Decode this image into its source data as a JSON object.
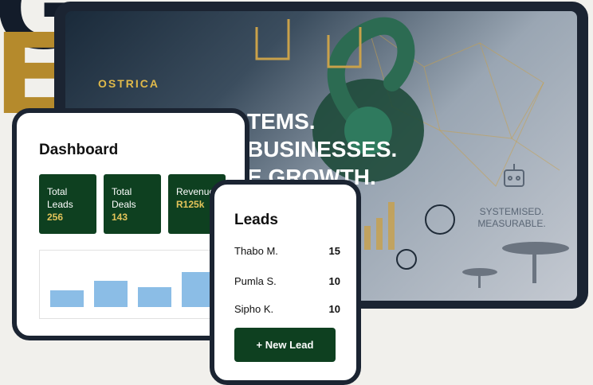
{
  "background": {
    "letter_top": "G",
    "letter_bottom": "E"
  },
  "hero": {
    "brand": "OSTRICA",
    "headline_lines": [
      "TEMS.",
      "BUSINESSES.",
      "E GROWTH."
    ],
    "tagline_lines": [
      "SYSTEMISED.",
      "MEASURABLE."
    ]
  },
  "colors": {
    "accent_green": "#0e4020",
    "accent_gold": "#e0b94a",
    "bar_blue": "#8bbde6",
    "frame_dark": "#1b2432"
  },
  "dashboard": {
    "title": "Dashboard",
    "stats": [
      {
        "label_1": "Total",
        "label_2": "Leads",
        "value": "256"
      },
      {
        "label_1": "Total",
        "label_2": "Deals",
        "value": "143"
      },
      {
        "label_1": "Revenue",
        "label_2": "",
        "value": "R125k"
      }
    ],
    "chart_data": {
      "type": "bar",
      "categories": [
        "",
        "",
        "",
        ""
      ],
      "values": [
        0.35,
        0.55,
        0.42,
        0.73
      ],
      "title": "",
      "xlabel": "",
      "ylabel": "",
      "ylim": [
        0,
        1
      ],
      "grid": false,
      "color": "#8bbde6"
    }
  },
  "leads": {
    "title": "Leads",
    "rows": [
      {
        "name": "Thabo M.",
        "count": "15"
      },
      {
        "name": "Pumla S.",
        "count": "10"
      },
      {
        "name": "Sipho K.",
        "count": "10"
      }
    ],
    "button_label": "+ New Lead"
  }
}
